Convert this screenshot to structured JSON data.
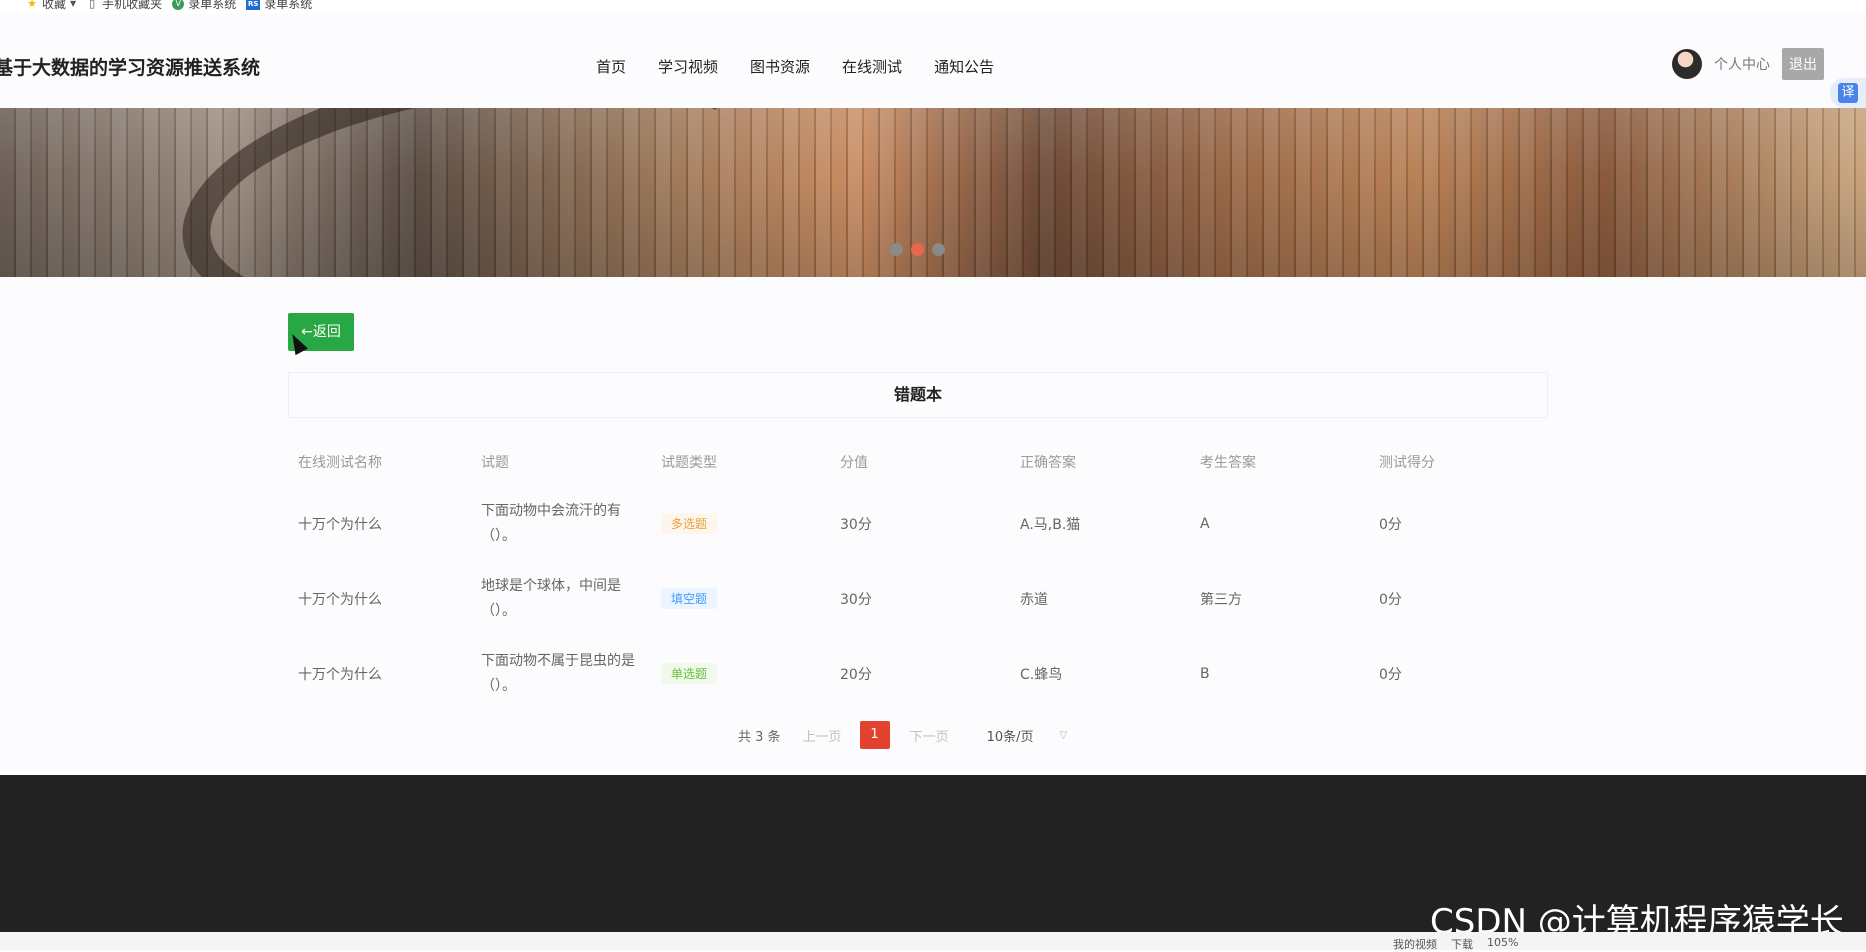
{
  "bookmarks": [
    {
      "icon": "star-icon",
      "label": "收藏"
    },
    {
      "icon": "phone-icon",
      "label": "手机收藏夹"
    },
    {
      "icon": "v-icon",
      "label": "录单系统"
    },
    {
      "icon": "rs-icon",
      "label": "录单系统"
    }
  ],
  "header": {
    "title": "基于大数据的学习资源推送系统",
    "nav": [
      "首页",
      "学习视频",
      "图书资源",
      "在线测试",
      "通知公告"
    ],
    "user_link": "个人中心",
    "logout": "退出",
    "translate": "译"
  },
  "page": {
    "back_label": "←返回",
    "panel_title": "错题本"
  },
  "table": {
    "headers": [
      "在线测试名称",
      "试题",
      "试题类型",
      "分值",
      "正确答案",
      "考生答案",
      "测试得分"
    ],
    "rows": [
      {
        "test": "十万个为什么",
        "question": "下面动物中会流汗的有（）。",
        "type": "多选题",
        "score": "30分",
        "correct": "A.马,B.猫",
        "answer": "A",
        "got": "0分"
      },
      {
        "test": "十万个为什么",
        "question": "地球是个球体，中间是（）。",
        "type": "填空题",
        "score": "30分",
        "correct": "赤道",
        "answer": "第三方",
        "got": "0分"
      },
      {
        "test": "十万个为什么",
        "question": "下面动物不属于昆虫的是（）。",
        "type": "单选题",
        "score": "20分",
        "correct": "C.蜂鸟",
        "answer": "B",
        "got": "0分"
      }
    ]
  },
  "pager": {
    "total": "共 3 条",
    "prev": "上一页",
    "current": "1",
    "next": "下一页",
    "size": "10条/页"
  },
  "overlay": {
    "watermark": "CSDN @计算机程序猿学长"
  },
  "taskbar": {
    "items": [
      "我的视频",
      "下载",
      "105%"
    ]
  },
  "colors": {
    "back_button": "#28a745",
    "pager_active": "#e2422e",
    "footer": "#222222"
  }
}
